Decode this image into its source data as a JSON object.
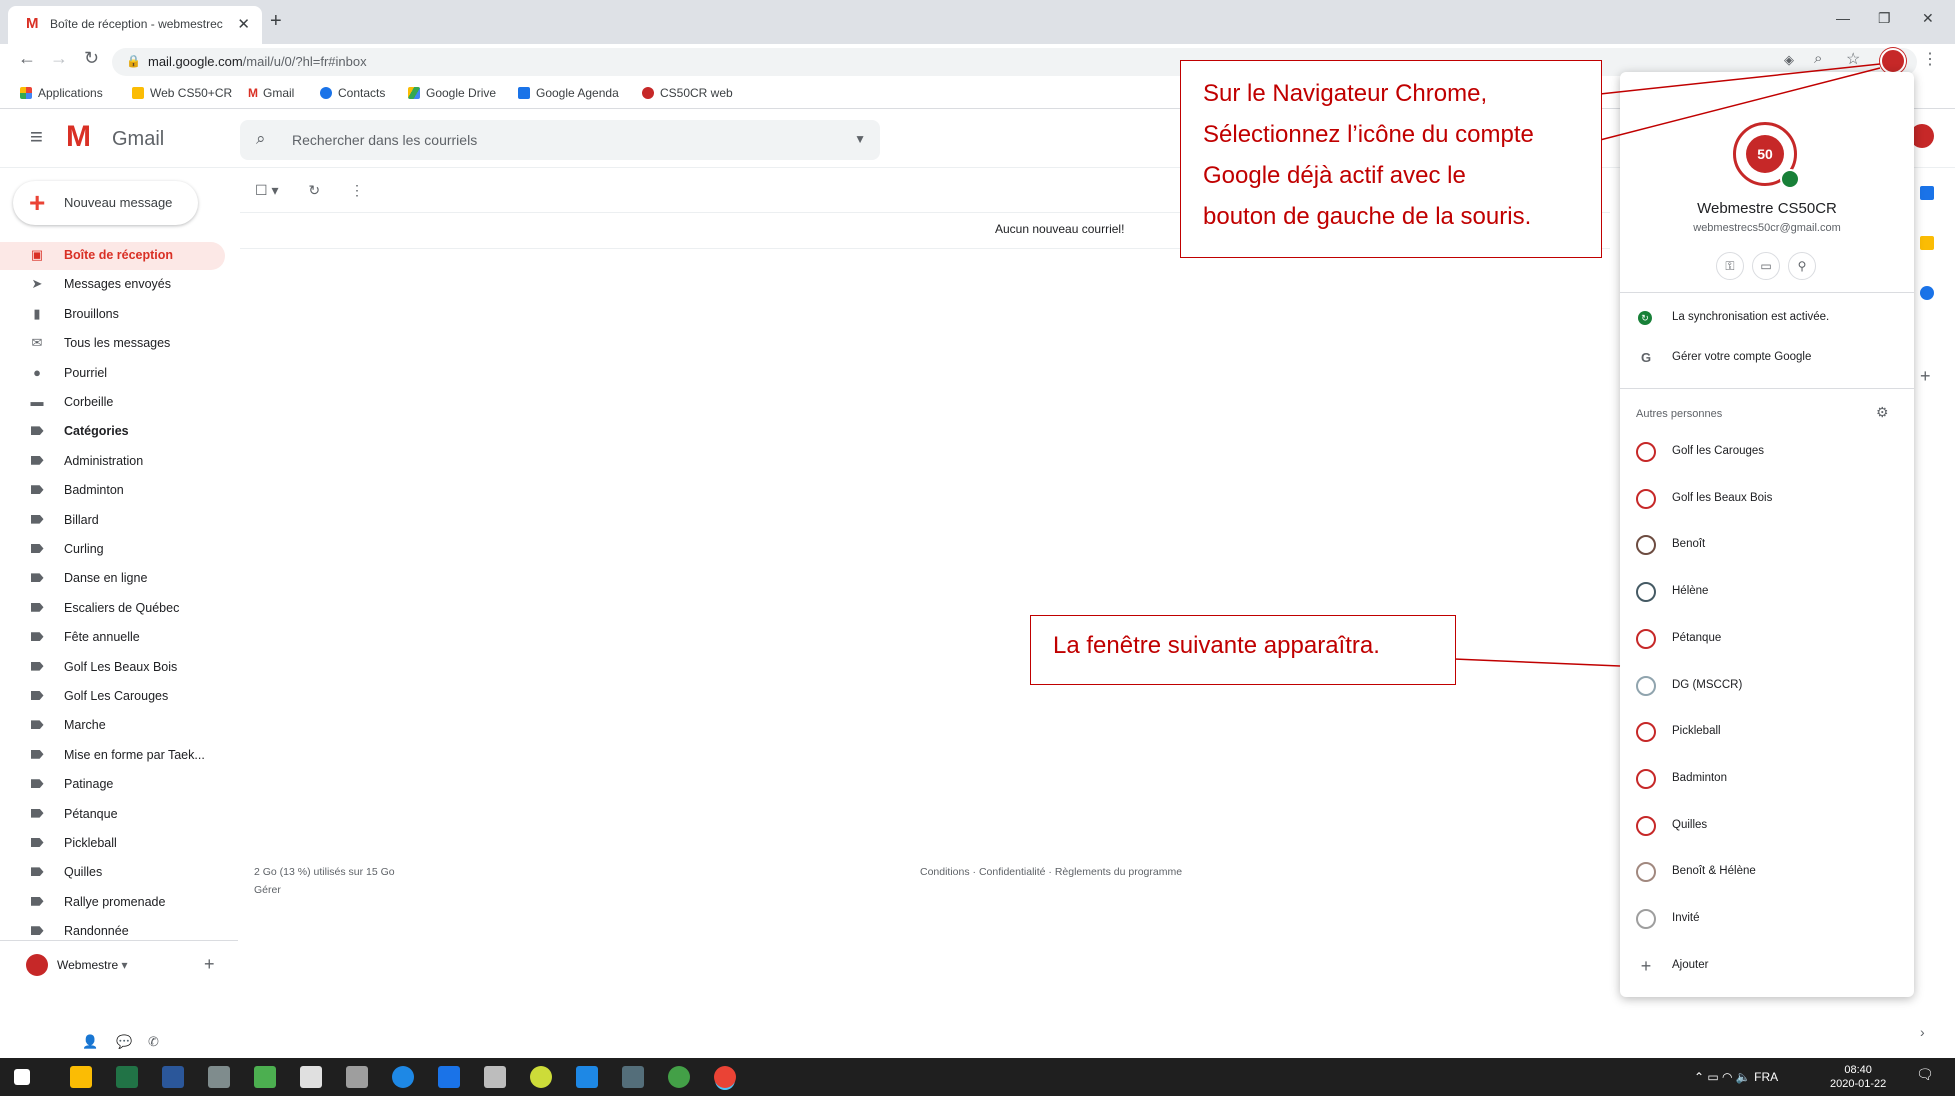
{
  "browser": {
    "tab_title": "Boîte de réception - webmestrec",
    "url_host": "mail.google.com",
    "url_path": "/mail/u/0/?hl=fr#inbox",
    "bookmarks": [
      "Applications",
      "Web CS50+CR",
      "Gmail",
      "Contacts",
      "Google Drive",
      "Google Agenda",
      "CS50CR web"
    ]
  },
  "gmail": {
    "product": "Gmail",
    "search_placeholder": "Rechercher dans les courriels",
    "compose_label": "Nouveau message",
    "nav": [
      {
        "label": "Boîte de réception",
        "icon": "inbox-icon"
      },
      {
        "label": "Messages envoyés",
        "icon": "send-icon"
      },
      {
        "label": "Brouillons",
        "icon": "draft-icon"
      },
      {
        "label": "Tous les messages",
        "icon": "mail-icon"
      },
      {
        "label": "Pourriel",
        "icon": "spam-icon"
      },
      {
        "label": "Corbeille",
        "icon": "trash-icon"
      },
      {
        "label": "Catégories",
        "icon": "label-icon"
      },
      {
        "label": "Administration",
        "icon": "label-icon"
      },
      {
        "label": "Badminton",
        "icon": "label-icon"
      },
      {
        "label": "Billard",
        "icon": "label-icon"
      },
      {
        "label": "Curling",
        "icon": "label-icon"
      },
      {
        "label": "Danse en ligne",
        "icon": "label-icon"
      },
      {
        "label": "Escaliers de Québec",
        "icon": "label-icon"
      },
      {
        "label": "Fête annuelle",
        "icon": "label-icon"
      },
      {
        "label": "Golf Les Beaux Bois",
        "icon": "label-icon"
      },
      {
        "label": "Golf Les Carouges",
        "icon": "label-icon"
      },
      {
        "label": "Marche",
        "icon": "label-icon"
      },
      {
        "label": "Mise en forme par Taek...",
        "icon": "label-icon"
      },
      {
        "label": "Patinage",
        "icon": "label-icon"
      },
      {
        "label": "Pétanque",
        "icon": "label-icon"
      },
      {
        "label": "Pickleball",
        "icon": "label-icon"
      },
      {
        "label": "Quilles",
        "icon": "label-icon"
      },
      {
        "label": "Rallye promenade",
        "icon": "label-icon"
      },
      {
        "label": "Randonnée",
        "icon": "label-icon"
      }
    ],
    "empty_message": "Aucun nouveau courriel!",
    "storage": "2 Go (13 %) utilisés sur 15 Go",
    "manage": "Gérer",
    "legal": "Conditions · Confidentialité · Règlements du programme",
    "hangouts_user": "Webmestre"
  },
  "account_popup": {
    "name": "Webmestre CS50CR",
    "email": "webmestrecs50cr@gmail.com",
    "sync": "La synchronisation est activée.",
    "manage": "Gérer votre compte Google",
    "others_heading": "Autres personnes",
    "people": [
      "Golf les Carouges",
      "Golf les Beaux Bois",
      "Benoît",
      "Hélène",
      "Pétanque",
      "DG (MSCCR)",
      "Pickleball",
      "Badminton",
      "Quilles",
      "Benoît & Hélène",
      "Invité",
      "Ajouter"
    ]
  },
  "annotations": {
    "callout1": [
      "Sur le Navigateur Chrome,",
      "Sélectionnez l’icône du compte",
      "Google déjà actif avec le",
      "bouton de gauche de la souris."
    ],
    "callout2": "La fenêtre suivante apparaîtra."
  },
  "taskbar": {
    "tray_lang": "FRA",
    "time": "08:40",
    "date": "2020-01-22"
  }
}
